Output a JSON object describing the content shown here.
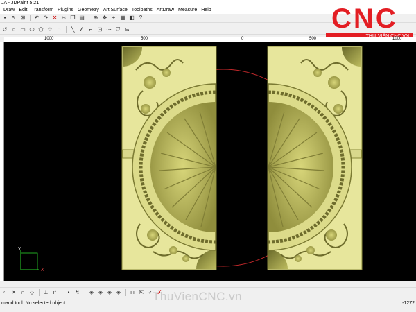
{
  "window": {
    "title": "JA - JDPaint 5.21"
  },
  "menu": [
    "Draw",
    "Edit",
    "Transform",
    "Plugins",
    "Geometry",
    "Art Surface",
    "Toolpaths",
    "ArtDraw",
    "Measure",
    "Help"
  ],
  "toolbar1": [
    "save-icon",
    "cursor-icon",
    "select-box-icon",
    "undo-icon",
    "redo-icon",
    "delete-icon",
    "cut-icon",
    "copy-icon",
    "paste-icon",
    "zoom-icon",
    "pan-icon",
    "plus-icon",
    "grid-icon",
    "layers-icon",
    "help-icon"
  ],
  "toolbar2": [
    "undo-draw-icon",
    "circle-icon",
    "rectangle-icon",
    "ellipse-icon",
    "polygon-icon",
    "star-icon",
    "arc-icon"
  ],
  "ruler": {
    "labels": [
      "1000",
      "500",
      "0",
      "500",
      "1000"
    ]
  },
  "axis": {
    "y": "Y",
    "x": "X"
  },
  "logo": {
    "text": "CNC",
    "subtitle": "THƯ VIỆN CNC.VN",
    "color": "#e31e24"
  },
  "status": {
    "left": "mand tool: No selected object",
    "right": "-1272"
  },
  "watermark": "ThuVienCNC.vn",
  "colors": {
    "panel": "#e7e69c",
    "canvas": "#000000",
    "circle": "#c0282a"
  }
}
